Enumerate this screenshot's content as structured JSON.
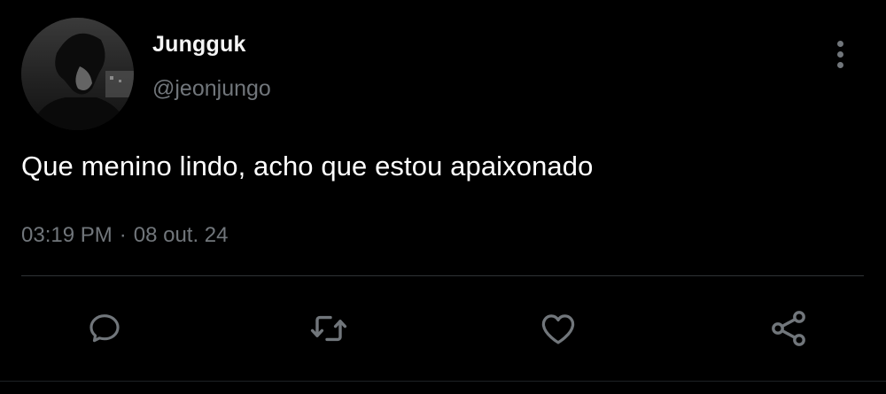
{
  "tweet": {
    "author": {
      "display_name": "Jungguk",
      "handle": "@jeonjungo",
      "avatar_icon": "profile-photo"
    },
    "text": "Que menino lindo, acho que estou apaixonado",
    "time": "03:19 PM",
    "separator": "·",
    "date": "08 out. 24",
    "actions": [
      {
        "name": "reply",
        "icon": "reply-icon"
      },
      {
        "name": "retweet",
        "icon": "retweet-icon"
      },
      {
        "name": "like",
        "icon": "heart-icon"
      },
      {
        "name": "share",
        "icon": "share-icon"
      }
    ]
  },
  "colors": {
    "background": "#000000",
    "text_primary": "#ffffff",
    "text_secondary": "#71767b",
    "divider": "#2f3336",
    "icon": "#71767b"
  }
}
